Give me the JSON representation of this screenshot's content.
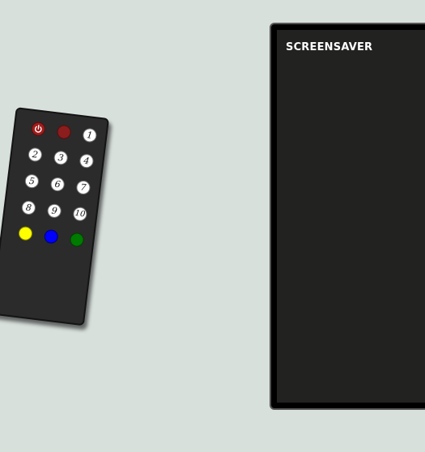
{
  "tv": {
    "screen_label": "SCREENSAVER"
  },
  "remote": {
    "power_icon": "power-icon",
    "buttons": {
      "b1": "1",
      "b2": "2",
      "b3": "3",
      "b4": "4",
      "b5": "5",
      "b6": "6",
      "b7": "7",
      "b8": "8",
      "b9": "9",
      "b10": "10"
    },
    "colors": {
      "background": "#d8e0dc",
      "remote_body": "#2b2b2b",
      "power": "#a01c1c",
      "red": "#8a1d1d",
      "yellow": "#ffff00",
      "blue": "#0000ff",
      "green": "#007a00",
      "screen": "#222221"
    }
  }
}
